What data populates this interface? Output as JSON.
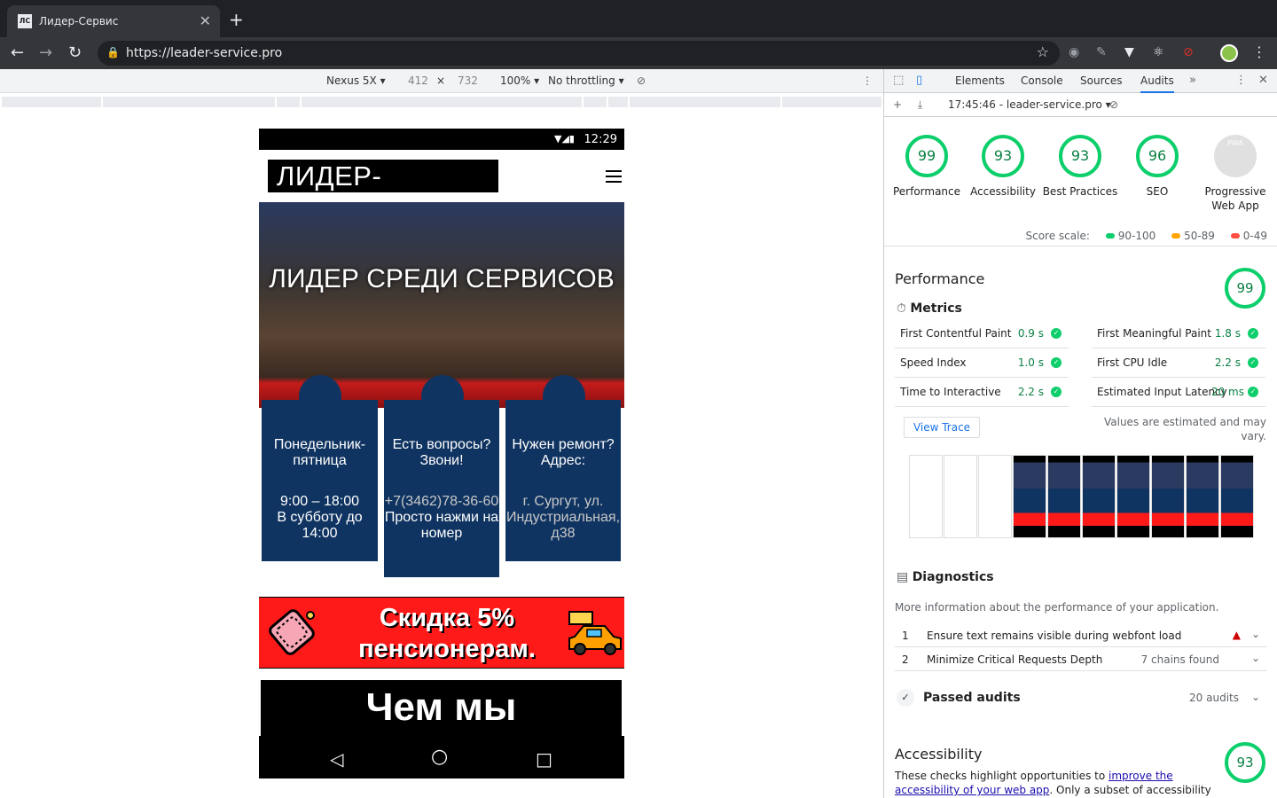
{
  "browser": {
    "tab_title": "Лидер-Сервис",
    "tab_favicon": "ЛС",
    "url": "https://leader-service.pro"
  },
  "device_toolbar": {
    "device": "Nexus 5X ▾",
    "width": "412",
    "times": "×",
    "height": "732",
    "zoom": "100% ▾",
    "throttling": "No throttling ▾"
  },
  "phone": {
    "time": "12:29",
    "logo": "ЛИДЕР-СЕРВИС",
    "hero_title": "ЛИДЕР СРЕДИ СЕРВИСОВ",
    "cards": [
      {
        "title": "Понедельник-пятница",
        "body1": "9:00 – 18:00",
        "body2": "В субботу до 14:00"
      },
      {
        "title": "Есть вопросы? Звони!",
        "body1": "+7(3462)78-36-60",
        "body2": "Просто нажми на номер"
      },
      {
        "title": "Нужен ремонт? Адрес:",
        "body1": "г. Сургут, ул. Индустриальная, д38",
        "body2": ""
      }
    ],
    "promo_line1": "Скидка 5%",
    "promo_line2": "пенсионерам.",
    "section_title": "Чем мы"
  },
  "devtools": {
    "tabs": [
      "Elements",
      "Console",
      "Sources",
      "Audits"
    ],
    "more": "»",
    "report": "17:45:46 - leader-service.pro ▾",
    "scores": [
      {
        "value": "99",
        "label": "Performance"
      },
      {
        "value": "93",
        "label": "Accessibility"
      },
      {
        "value": "93",
        "label": "Best Practices"
      },
      {
        "value": "96",
        "label": "SEO"
      }
    ],
    "pwa_badge": "PWA",
    "pwa_label": "Progressive Web App",
    "scale_label": "Score scale:",
    "scale": [
      "90-100",
      "50-89",
      "0-49"
    ],
    "colors": {
      "pass": "#0cce6b",
      "average": "#ffa400",
      "fail": "#ff4e42"
    },
    "performance_title": "Performance",
    "performance_score": "99",
    "metrics_head": "Metrics",
    "metrics": [
      {
        "name": "First Contentful Paint",
        "value": "0.9 s"
      },
      {
        "name": "First Meaningful Paint",
        "value": "1.8 s"
      },
      {
        "name": "Speed Index",
        "value": "1.0 s"
      },
      {
        "name": "First CPU Idle",
        "value": "2.2 s"
      },
      {
        "name": "Time to Interactive",
        "value": "2.2 s"
      },
      {
        "name": "Estimated Input Latency",
        "value": "20 ms"
      }
    ],
    "view_trace": "View Trace",
    "estimated_note": "Values are estimated and may vary.",
    "diagnostics_head": "Diagnostics",
    "diagnostics_desc": "More information about the performance of your application.",
    "diagnostics": [
      {
        "num": "1",
        "text": "Ensure text remains visible during webfont load",
        "meta": ""
      },
      {
        "num": "2",
        "text": "Minimize Critical Requests Depth",
        "meta": "7 chains found"
      }
    ],
    "passed_label": "Passed audits",
    "passed_count": "20 audits",
    "accessibility_title": "Accessibility",
    "accessibility_score": "93",
    "acc_desc_pre": "These checks highlight opportunities to ",
    "acc_desc_link": "improve the accessibility of your web app",
    "acc_desc_post": ". Only a subset of accessibility issues can be"
  }
}
